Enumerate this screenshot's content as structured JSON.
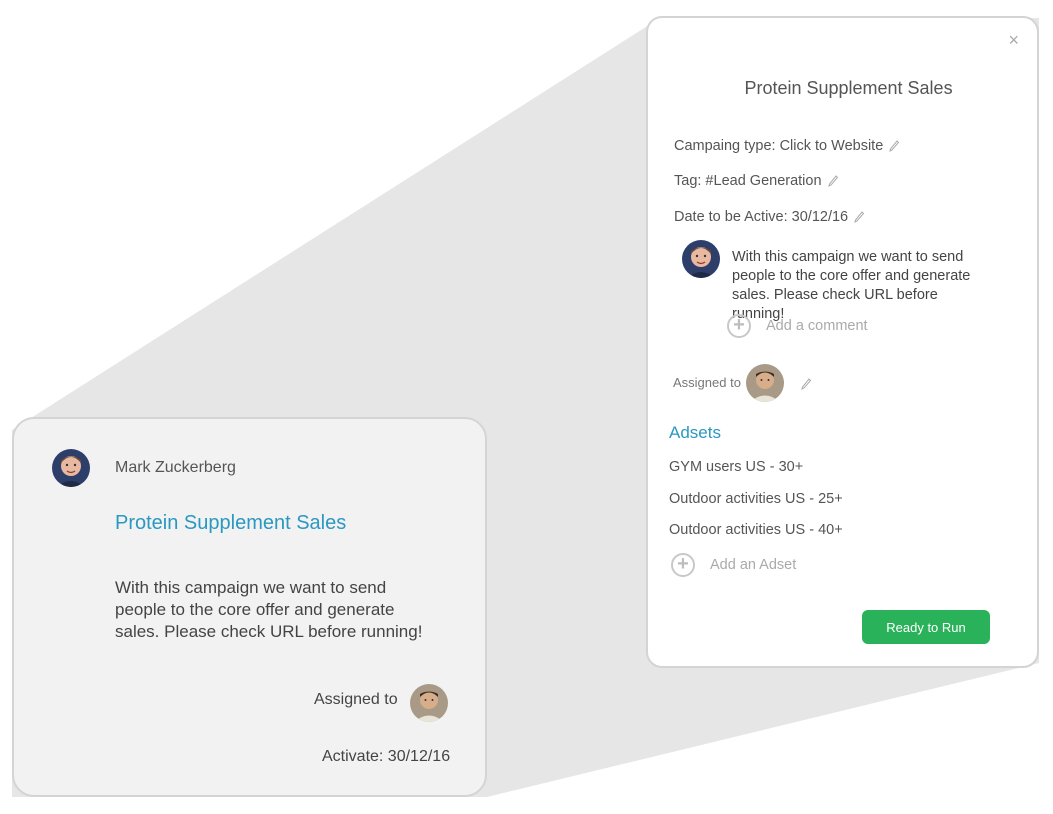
{
  "card": {
    "author_name": "Mark Zuckerberg",
    "title": "Protein Supplement Sales",
    "description": "With this campaign we want to send people to the core offer and generate sales. Please check URL before running!",
    "assigned_label": "Assigned to",
    "activate": "Activate: 30/12/16"
  },
  "panel": {
    "close_icon": "×",
    "title": "Protein Supplement Sales",
    "campaign_type": "Campaing type: Click to Website",
    "tag": "Tag: #Lead Generation",
    "date_active": "Date to be Active: 30/12/16",
    "comment": "With this campaign we want to send people to the core offer and generate sales. Please check URL before running!",
    "add_comment": "Add a comment",
    "assigned_label": "Assigned to",
    "adsets_heading": "Adsets",
    "adsets": [
      "GYM users US - 30+",
      "Outdoor activities US - 25+",
      "Outdoor activities US - 40+"
    ],
    "add_adset": "Add an Adset",
    "ready_button": "Ready to Run",
    "plus_icon": "+"
  },
  "colors": {
    "accent": "#2a98c0",
    "button": "#2ab25a",
    "card_bg": "#f2f2f2",
    "zoom_shadow": "#e6e6e6"
  },
  "icons": [
    "close-icon",
    "pencil-icon",
    "plus-circle-icon",
    "avatar"
  ]
}
